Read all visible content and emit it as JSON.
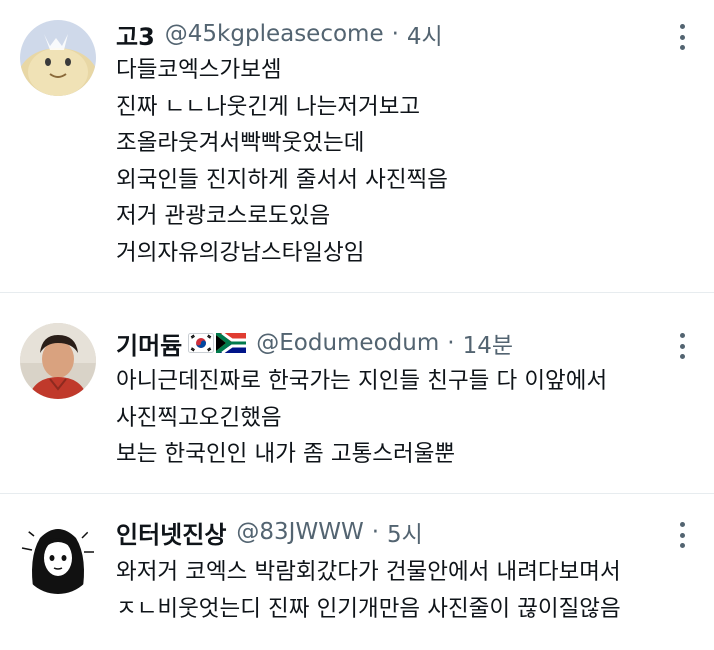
{
  "tweets": [
    {
      "name": "고3",
      "handle": "@45kgpleasecome",
      "separator": "·",
      "time": "4시",
      "lines": [
        "다들코엑스가보셈",
        "진짜 ㄴㄴ나웃긴게 나는저거보고",
        "조올라웃겨서빡빡웃었는데",
        "외국인들 진지하게 줄서서 사진찍음",
        "저거 관광코스로도있음",
        "거의자유의강남스타일상임"
      ],
      "flags": []
    },
    {
      "name": "기머듐",
      "handle": "@Eodumeodum",
      "separator": "·",
      "time": "14분",
      "lines": [
        "아니근데진짜로 한국가는 지인들 친구들 다 이앞에서",
        "사진찍고오긴했음",
        "보는 한국인인 내가 좀 고통스러울뿐"
      ],
      "flags": [
        "south-korea-flag-icon",
        "south-africa-flag-icon"
      ]
    },
    {
      "name": "인터넷진상",
      "handle": "@83JWWW",
      "separator": "·",
      "time": "5시",
      "lines": [
        "와저거 코엑스 박람회갔다가 건물안에서 내려다보며서",
        "ㅈㄴ비웃엇는디 진짜 인기개만음 사진줄이 끊이질않음"
      ],
      "flags": []
    }
  ],
  "colors": {
    "text": "#0f1419",
    "secondary": "#536471",
    "divider": "#e7ecef",
    "background": "#ffffff"
  }
}
